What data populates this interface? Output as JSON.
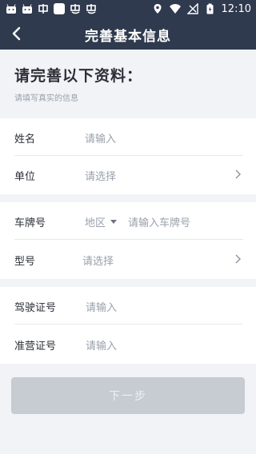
{
  "statusbar": {
    "left_icons": [
      "android-robot-icon",
      "android-robot-icon",
      "carrier-icon",
      "notification-square-icon",
      "worm-icon",
      "worm-icon"
    ],
    "time": "12:10",
    "right_icons": [
      "location-icon",
      "wifi-icon",
      "signal-icon",
      "battery-icon"
    ]
  },
  "appbar": {
    "title": "完善基本信息"
  },
  "header": {
    "heading": "请完善以下资料：",
    "subheading": "请填写真实的信息"
  },
  "form": {
    "name": {
      "label": "姓名",
      "placeholder": "请输入"
    },
    "unit": {
      "label": "单位",
      "placeholder": "请选择"
    },
    "plate": {
      "label": "车牌号",
      "region": "地区",
      "placeholder": "请输入车牌号"
    },
    "model": {
      "label": "型号",
      "placeholder": "请选择"
    },
    "license": {
      "label": "驾驶证号",
      "placeholder": "请输入"
    },
    "permit": {
      "label": "准营证号",
      "placeholder": "请输入"
    }
  },
  "actions": {
    "next_label": "下一步"
  },
  "colors": {
    "appbar": "#2f3a4e",
    "background": "#f1f3f7",
    "button_disabled": "#c7cbd2",
    "placeholder": "#9aa1ab"
  }
}
